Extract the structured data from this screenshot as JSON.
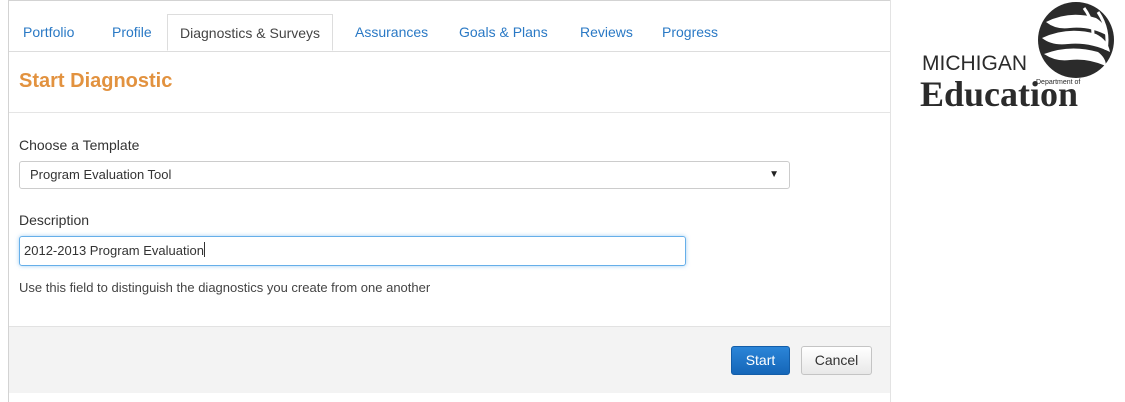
{
  "nav": {
    "tabs": [
      {
        "label": "Portfolio"
      },
      {
        "label": "Profile"
      },
      {
        "label": "Diagnostics & Surveys"
      },
      {
        "label": "Assurances"
      },
      {
        "label": "Goals & Plans"
      },
      {
        "label": "Reviews"
      },
      {
        "label": "Progress"
      }
    ],
    "active_tab": "Diagnostics & Surveys"
  },
  "page": {
    "title": "Start Diagnostic"
  },
  "form": {
    "template_label": "Choose a Template",
    "template_value": "Program Evaluation Tool",
    "description_label": "Description",
    "description_value": "2012-2013 Program Evaluation",
    "description_help": "Use this field to distinguish the diagnostics you create from one another"
  },
  "footer": {
    "start_label": "Start",
    "cancel_label": "Cancel"
  },
  "logo": {
    "line1": "MICHIGAN",
    "line2": "Department of",
    "line3": "Education"
  },
  "colors": {
    "title": "#e2923f",
    "tab_link": "#2a79c5",
    "primary_button": "#1a6fc4"
  }
}
